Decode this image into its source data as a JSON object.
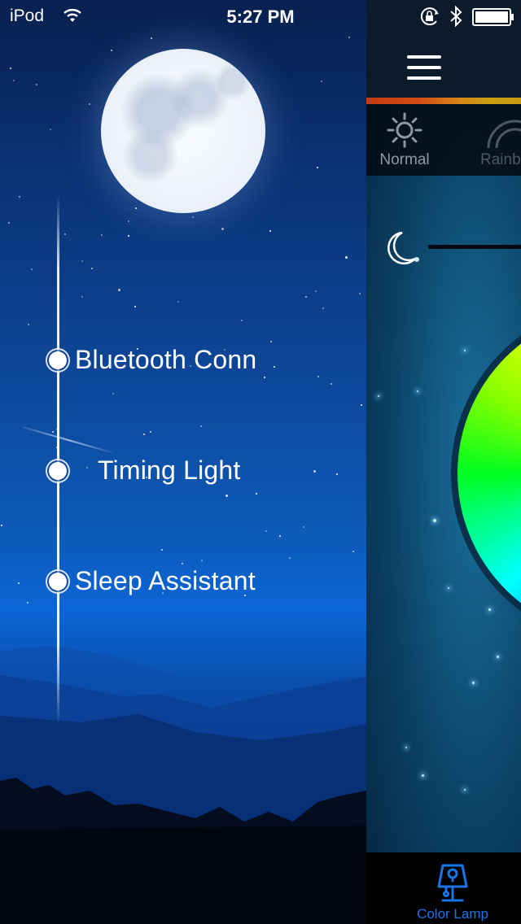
{
  "status_bar": {
    "carrier": "iPod",
    "time": "5:27 PM",
    "icons": [
      "wifi-icon",
      "orientation-lock-icon",
      "bluetooth-icon",
      "battery-icon"
    ],
    "battery_level": 1.0
  },
  "side_menu": {
    "items": [
      {
        "label": "Bluetooth Conn",
        "icon": "radio-dot-icon"
      },
      {
        "label": "Timing Light",
        "icon": "radio-dot-icon"
      },
      {
        "label": "Sleep Assistant",
        "icon": "radio-dot-icon"
      }
    ]
  },
  "main_panel": {
    "header": {
      "menu_icon": "hamburger-icon"
    },
    "mode_tabs": [
      {
        "label": "Normal",
        "icon": "sun-icon"
      },
      {
        "label": "Rainbow",
        "visible_label": "Rainb",
        "icon": "rainbow-icon"
      }
    ],
    "brightness": {
      "icon": "moon-icon"
    },
    "bottom_tabs": [
      {
        "label": "Color Lamp",
        "icon": "lamp-icon",
        "active": true
      }
    ]
  },
  "colors": {
    "accent_blue": "#1a75e8",
    "header_bg": "#0b1b2c",
    "accent_bar_start": "#c43b12",
    "accent_bar_end": "#c79a10",
    "inactive_tab_text": "#8e99a3"
  }
}
